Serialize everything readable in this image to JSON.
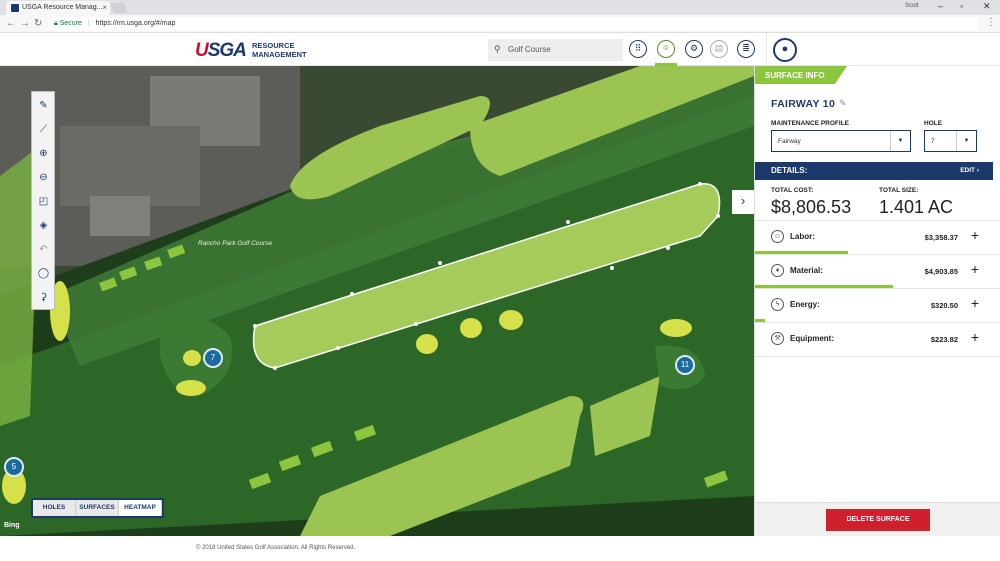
{
  "browser": {
    "tab_title": "USGA Resource Manag...",
    "tab_close": "×",
    "window_user": "Scott",
    "secure_label": "Secure",
    "url": "https://rm.usga.org/#/map"
  },
  "header": {
    "logo_main": "USGA",
    "logo_sub": "RESOURCE MANAGEMENT",
    "search_value": "Golf Course",
    "icons": [
      "grid-icon",
      "map-pin-icon",
      "gear-icon",
      "clipboard-icon",
      "list-doc-icon",
      "user-icon"
    ]
  },
  "map": {
    "course_label": "Rancho Park Golf Course",
    "attribution": "Bing",
    "holes": [
      "7",
      "11",
      "5"
    ],
    "view_toggle": [
      "HOLES",
      "SURFACES",
      "HEATMAP"
    ],
    "active_view": "HEATMAP",
    "tools": [
      "pencil-icon",
      "ruler-icon",
      "zoom-in-icon",
      "zoom-out-icon",
      "edit-shape-icon",
      "layers-icon",
      "undo-icon",
      "lasso-icon",
      "golfer-icon"
    ]
  },
  "panel": {
    "tab_label": "SURFACE INFO",
    "title": "FAIRWAY 10",
    "maintenance_profile_label": "MAINTENANCE PROFILE",
    "maintenance_profile_value": "Fairway",
    "hole_label": "HOLE",
    "hole_value": "7",
    "details_label": "DETAILS:",
    "edit_label": "EDIT ›",
    "total_cost_label": "TOTAL COST:",
    "total_cost_value": "$8,806.53",
    "total_size_label": "TOTAL SIZE:",
    "total_size_value": "1.401 AC",
    "rows": [
      {
        "label": "Labor:",
        "value": "$3,358.37",
        "icon": "labor-icon",
        "share": 0.38
      },
      {
        "label": "Material:",
        "value": "$4,903.85",
        "icon": "material-icon",
        "share": 0.56
      },
      {
        "label": "Energy:",
        "value": "$320.50",
        "icon": "energy-icon",
        "share": 0.04
      },
      {
        "label": "Equipment:",
        "value": "$223.82",
        "icon": "equipment-icon",
        "share": 0.03
      }
    ],
    "delete_label": "DELETE SURFACE"
  },
  "footer": {
    "copyright": "© 2018 United States Golf Association. All Rights Reserved."
  },
  "colors": {
    "navy": "#1b3a6b",
    "green": "#8cc63f",
    "red": "#d0202e"
  }
}
